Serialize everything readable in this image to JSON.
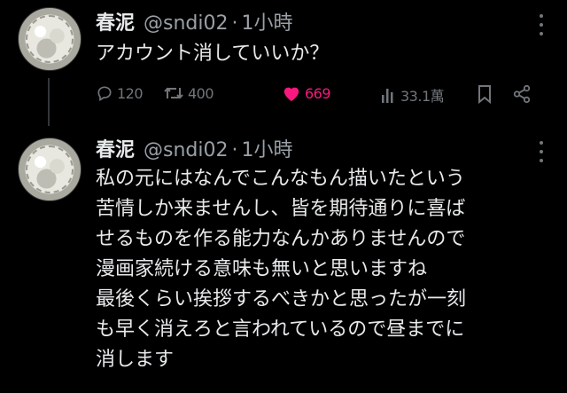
{
  "posts": [
    {
      "author": {
        "name": "春泥",
        "handle": "@sndi02",
        "separator": "·",
        "time": "1小時"
      },
      "text_lines": [
        "アカウント消していいか？"
      ],
      "stats": {
        "replies": "120",
        "reposts": "400",
        "likes": "669",
        "views": "33.1萬"
      }
    },
    {
      "author": {
        "name": "春泥",
        "handle": "@sndi02",
        "separator": "·",
        "time": "1小時"
      },
      "text_lines": [
        "私の元にはなんでこんなもん描いたという",
        "苦情しか来ませんし、皆を期待通りに喜ば",
        "せるものを作る能力なんかありませんので",
        "漫画家続ける意味も無いと思いますね",
        "最後くらい挨拶するべきかと思ったが一刻",
        "も早く消えろと言われているので昼までに",
        "消します"
      ]
    }
  ],
  "colors": {
    "background": "#000000",
    "text": "#e7e9ea",
    "muted": "#71767b",
    "like": "#f91880"
  },
  "icons": [
    "more-icon",
    "reply-icon",
    "repost-icon",
    "heart-icon",
    "views-icon",
    "bookmark-icon",
    "share-icon"
  ]
}
